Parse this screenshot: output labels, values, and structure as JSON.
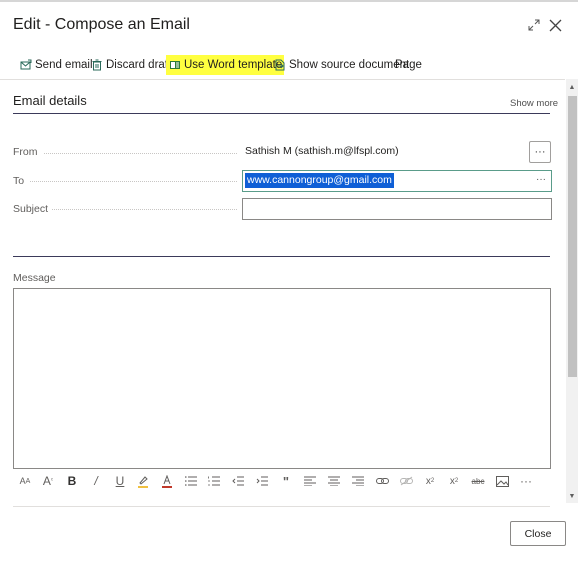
{
  "dialog": {
    "title": "Edit - Compose an Email",
    "expand_icon": "expand-diagonal-icon",
    "close_icon": "close-x-icon"
  },
  "toolbar": {
    "send_email": "Send email",
    "discard_draft": "Discard draft",
    "use_word_template": "Use Word template",
    "show_source_document": "Show source document",
    "page": "Page",
    "highlight_color": "#ffff40"
  },
  "email_details": {
    "title": "Email details",
    "show_more": "Show more",
    "from_label": "From",
    "from_value": "Sathish M (sathish.m@lfspl.com)",
    "to_label": "To",
    "to_value": "www.cannongroup@gmail.com",
    "subject_label": "Subject",
    "subject_value": "",
    "lookup_button": "···",
    "to_lookup": "···"
  },
  "message": {
    "label": "Message",
    "body": ""
  },
  "editor_toolbar": {
    "more": "···"
  },
  "footer": {
    "close_label": "Close"
  }
}
